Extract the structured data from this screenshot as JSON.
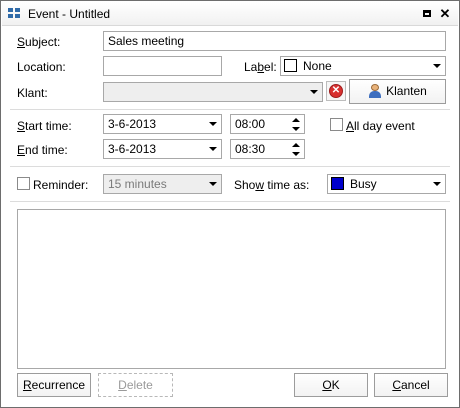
{
  "window": {
    "title": "Event - Untitled",
    "restore_icon": "restore-icon",
    "close_icon": "close-icon"
  },
  "form": {
    "subject_label": "Subject:",
    "subject_value": "Sales meeting",
    "location_label": "Location:",
    "location_value": "",
    "label_label": "Label:",
    "label_value": "None",
    "label_color": "#ffffff",
    "klant_label": "Klant:",
    "klant_value": "",
    "klanten_button": "Klanten",
    "start_label": "Start time:",
    "start_date": "3-6-2013",
    "start_time": "08:00",
    "end_label": "End time:",
    "end_date": "3-6-2013",
    "end_time": "08:30",
    "allday_label": "All day event",
    "allday_checked": false,
    "reminder_label": "Reminder:",
    "reminder_checked": false,
    "reminder_value": "15 minutes",
    "showtime_label": "Show time as:",
    "showtime_value": "Busy",
    "showtime_color": "#0000cc",
    "notes": ""
  },
  "buttons": {
    "recurrence": "Recurrence",
    "delete": "Delete",
    "ok": "OK",
    "cancel": "Cancel"
  }
}
